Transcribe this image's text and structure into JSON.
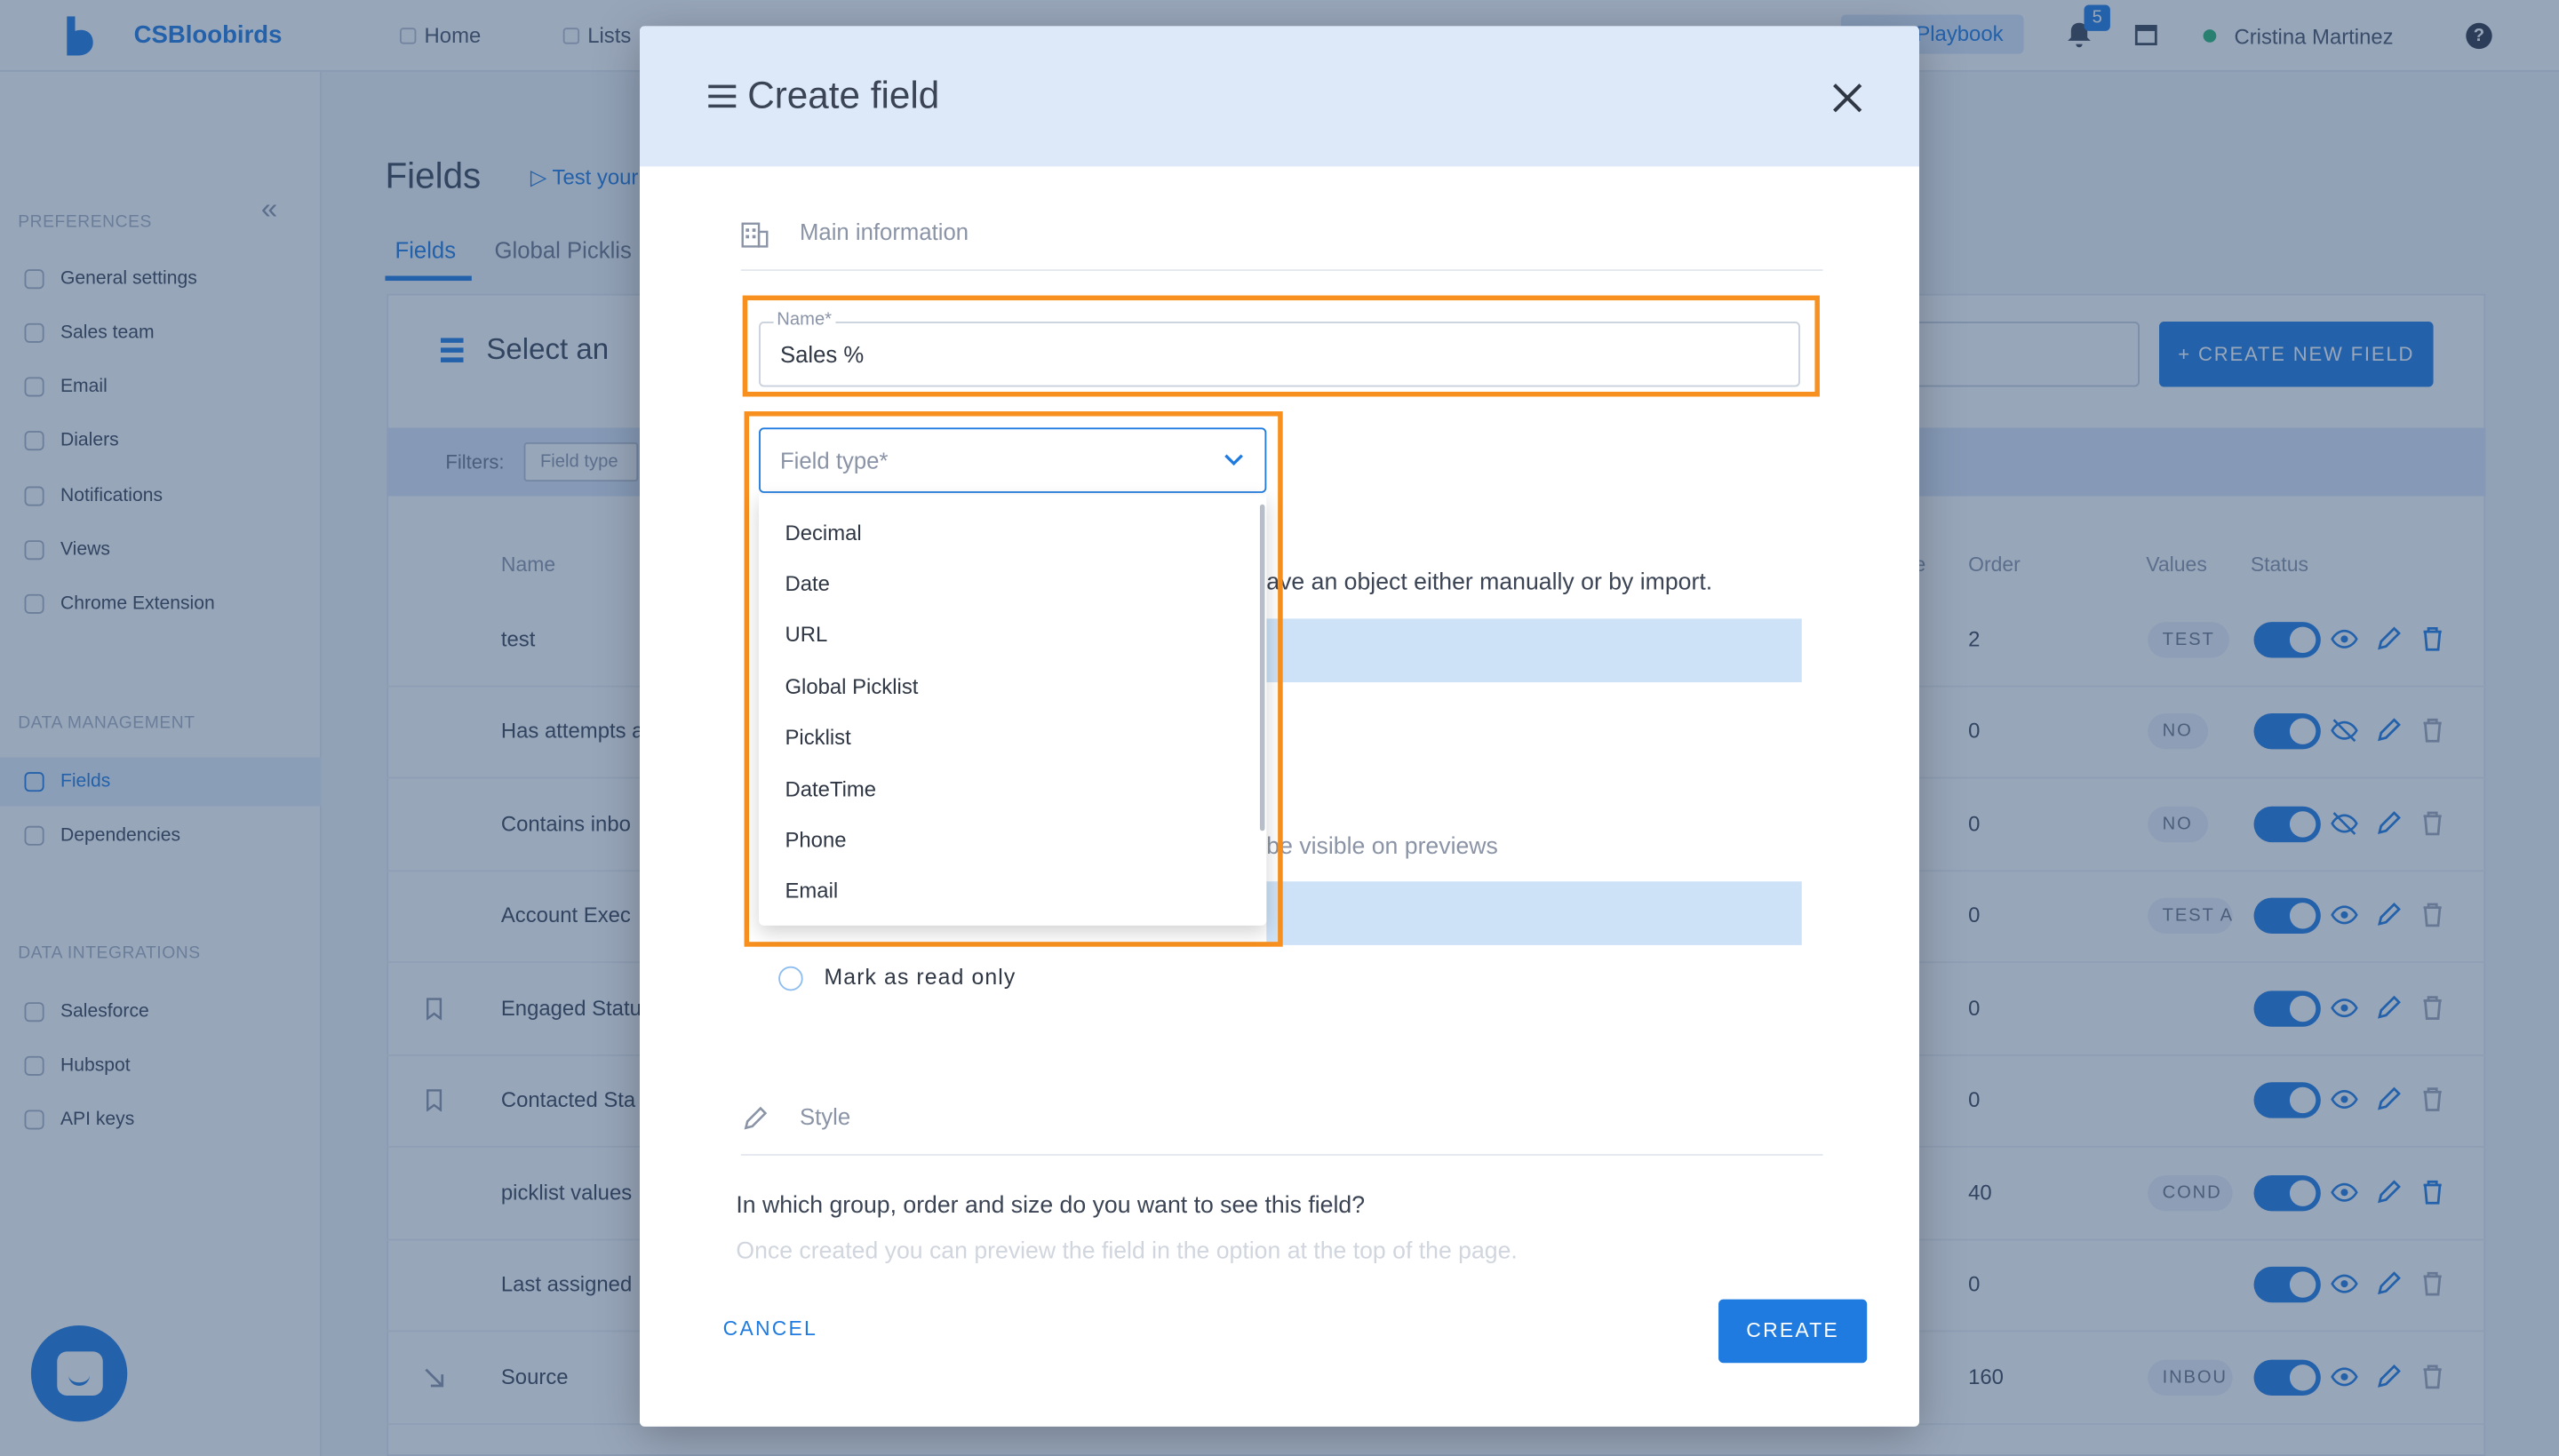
{
  "app": {
    "name": "CSBloobirds"
  },
  "topnav": {
    "items": [
      {
        "label": "Home"
      },
      {
        "label": "Lists"
      }
    ],
    "playbook_label": "Playbook",
    "notifications_count": "5",
    "user_name": "Cristina Martinez",
    "help": "?"
  },
  "sidebar": {
    "sections": [
      {
        "title": "PREFERENCES",
        "items": [
          {
            "label": "General settings"
          },
          {
            "label": "Sales team"
          },
          {
            "label": "Email"
          },
          {
            "label": "Dialers"
          },
          {
            "label": "Notifications"
          },
          {
            "label": "Views"
          },
          {
            "label": "Chrome Extension"
          }
        ]
      },
      {
        "title": "DATA MANAGEMENT",
        "items": [
          {
            "label": "Fields"
          },
          {
            "label": "Dependencies"
          }
        ]
      },
      {
        "title": "DATA INTEGRATIONS",
        "items": [
          {
            "label": "Salesforce"
          },
          {
            "label": "Hubspot"
          },
          {
            "label": "API keys"
          }
        ]
      }
    ]
  },
  "page": {
    "title": "Fields",
    "test_link": "Test your",
    "tabs": [
      {
        "label": "Fields"
      },
      {
        "label": "Global Picklis"
      }
    ],
    "select_object": "Select an",
    "create_new_field": "+ CREATE NEW FIELD",
    "filters_label": "Filters:",
    "filter_field_type": "Field type",
    "table": {
      "headers": {
        "name": "Name",
        "order": "Order",
        "values": "Values",
        "status": "Status",
        "partial": "e"
      },
      "rows": [
        {
          "name": "test",
          "order": "2",
          "badge": "TEST"
        },
        {
          "name": "Has attempts a",
          "order": "0",
          "badge": "NO"
        },
        {
          "name": "Contains inbo",
          "order": "0",
          "badge": "NO"
        },
        {
          "name": "Account Exec",
          "order": "0",
          "badge": "TEST A"
        },
        {
          "name": "Engaged Statu",
          "order": "0",
          "badge": ""
        },
        {
          "name": "Contacted Sta",
          "order": "0",
          "badge": ""
        },
        {
          "name": "picklist values",
          "order": "40",
          "badge": "COND"
        },
        {
          "name": "Last assigned",
          "order": "0",
          "badge": ""
        },
        {
          "name": "Source",
          "order": "160",
          "badge": "INBOU"
        }
      ]
    }
  },
  "modal": {
    "title": "Create field",
    "main_info_label": "Main information",
    "name_field": {
      "label": "Name*",
      "value": "Sales %"
    },
    "field_type": {
      "placeholder": "Field type*",
      "options": [
        "Decimal",
        "Date",
        "URL",
        "Global Picklist",
        "Picklist",
        "DateTime",
        "Phone",
        "Email"
      ]
    },
    "helper_text_1": "ave an object either manually or by import.",
    "helper_text_2": "be visible on previews",
    "read_only_label": "Mark as read only",
    "style_label": "Style",
    "group_question": "In which group, order and size do you want to see this field?",
    "group_hint": "Once created you can preview the field in the option at the top of the page.",
    "cancel_label": "CANCEL",
    "create_label": "CREATE"
  },
  "colors": {
    "accent": "#1f7be0",
    "highlight": "#f7901e",
    "overlay": "#28466e"
  }
}
